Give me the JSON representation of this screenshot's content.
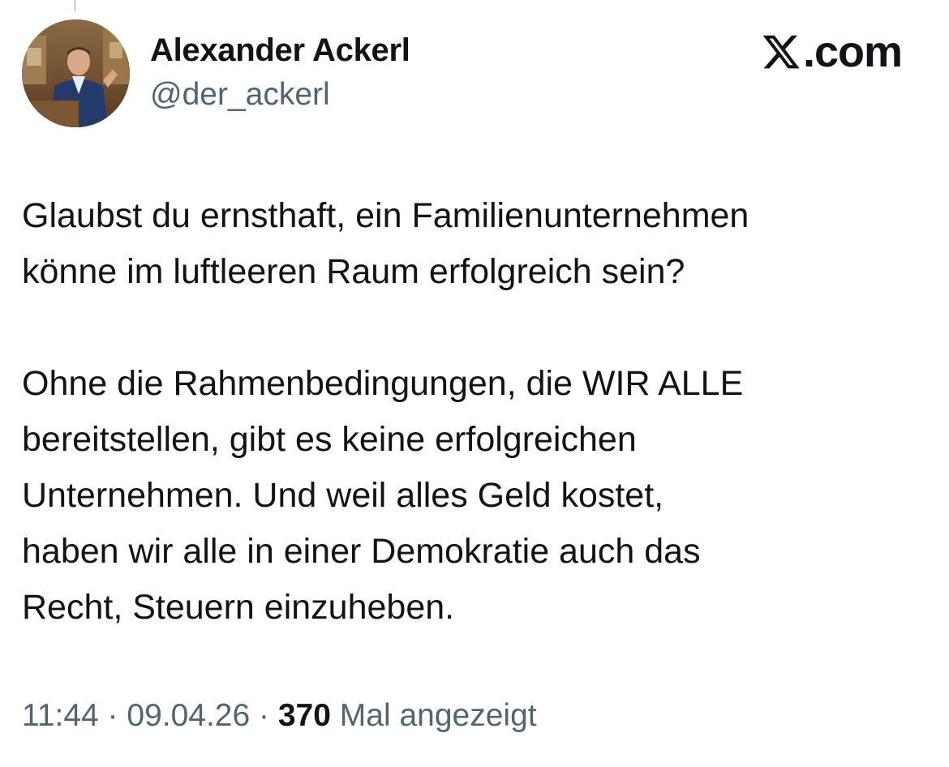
{
  "author": {
    "display_name": "Alexander Ackerl",
    "handle": "@der_ackerl"
  },
  "brand": {
    "text": ".com",
    "icon": "x-logo-icon"
  },
  "tweet": {
    "paragraphs": [
      "Glaubst du ernsthaft, ein Familienunternehmen\nkönne im luftleeren Raum erfolgreich sein?",
      "Ohne die Rahmenbedingungen, die WIR ALLE\nbereitstellen, gibt es keine erfolgreichen\nUnternehmen. Und weil alles Geld kostet,\nhaben wir alle in einer Demokratie auch das\nRecht, Steuern einzuheben."
    ]
  },
  "meta": {
    "time": "11:44",
    "date": "09.04.26",
    "separator": " · ",
    "views_count": "370",
    "views_label": " Mal angezeigt"
  },
  "colors": {
    "text_primary": "#0f1419",
    "text_secondary": "#536471",
    "thread_line": "#cfd9de",
    "background": "#ffffff"
  }
}
